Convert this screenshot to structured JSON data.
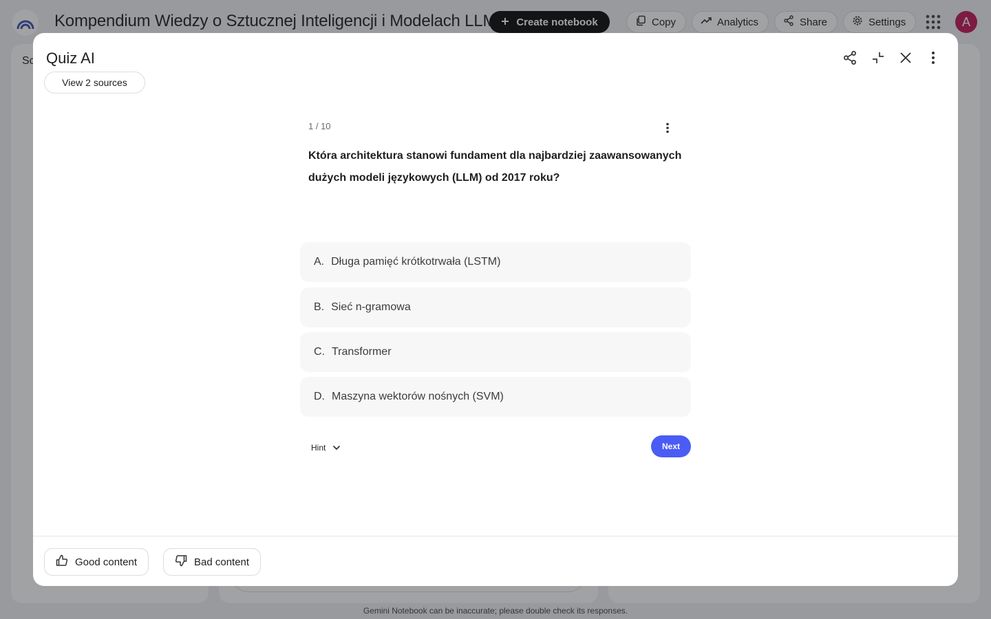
{
  "app": {
    "title": "Kompendium Wiedzy o Sztucznej Inteligencji i Modelach LLM",
    "create_label": "Create notebook",
    "copy_label": "Copy",
    "analytics_label": "Analytics",
    "share_label": "Share",
    "settings_label": "Settings",
    "avatar_letter": "A",
    "sources_panel_label_partial": "Sc",
    "disclaimer": "Gemini Notebook can be inaccurate; please double check its responses.",
    "accent_color": "#4b5cf5"
  },
  "modal": {
    "title": "Quiz AI",
    "sources_button": "View 2 sources",
    "header_icons": [
      "share-icon",
      "collapse-icon",
      "close-icon",
      "more-vert-icon"
    ]
  },
  "quiz": {
    "counter": "1 / 10",
    "question": "Która architektura stanowi fundament dla najbardziej zaawansowanych dużych modeli językowych (LLM) od 2017 roku?",
    "options": [
      {
        "letter": "A.",
        "text": "Długa pamięć krótkotrwała (LSTM)"
      },
      {
        "letter": "B.",
        "text": "Sieć n-gramowa"
      },
      {
        "letter": "C.",
        "text": "Transformer"
      },
      {
        "letter": "D.",
        "text": "Maszyna wektorów nośnych (SVM)"
      }
    ],
    "hint_label": "Hint",
    "next_label": "Next"
  },
  "feedback": {
    "good_label": "Good content",
    "bad_label": "Bad content"
  }
}
